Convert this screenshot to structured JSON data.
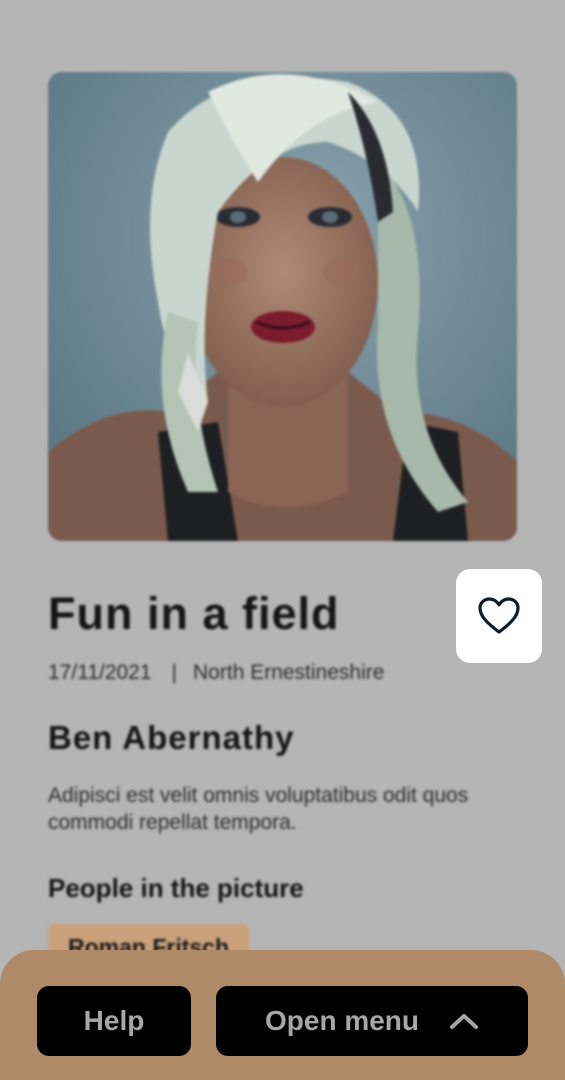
{
  "photo": {
    "icon": "portrait-photo"
  },
  "post": {
    "title": "Fun in a field",
    "date": "17/11/2021",
    "separator": "|",
    "location": "North Ernestineshire",
    "author": "Ben Abernathy",
    "description": "Adipisci est velit omnis voluptatibus odit quos commodi repellat tempora."
  },
  "people": {
    "label": "People in the picture",
    "items": [
      "Roman Fritsch"
    ]
  },
  "favorite": {
    "icon": "heart-outline-icon"
  },
  "bottom_bar": {
    "help_label": "Help",
    "menu_label": "Open menu",
    "menu_icon": "chevron-up-icon"
  },
  "colors": {
    "overlay_background": "#b5b5b5",
    "tag_background": "#c9a17b",
    "bottom_bar_background": "#ae8a69",
    "button_background": "#000000",
    "button_text": "#a6a6a6",
    "favorite_background": "#ffffff",
    "heart_stroke": "#0d1b2a"
  }
}
